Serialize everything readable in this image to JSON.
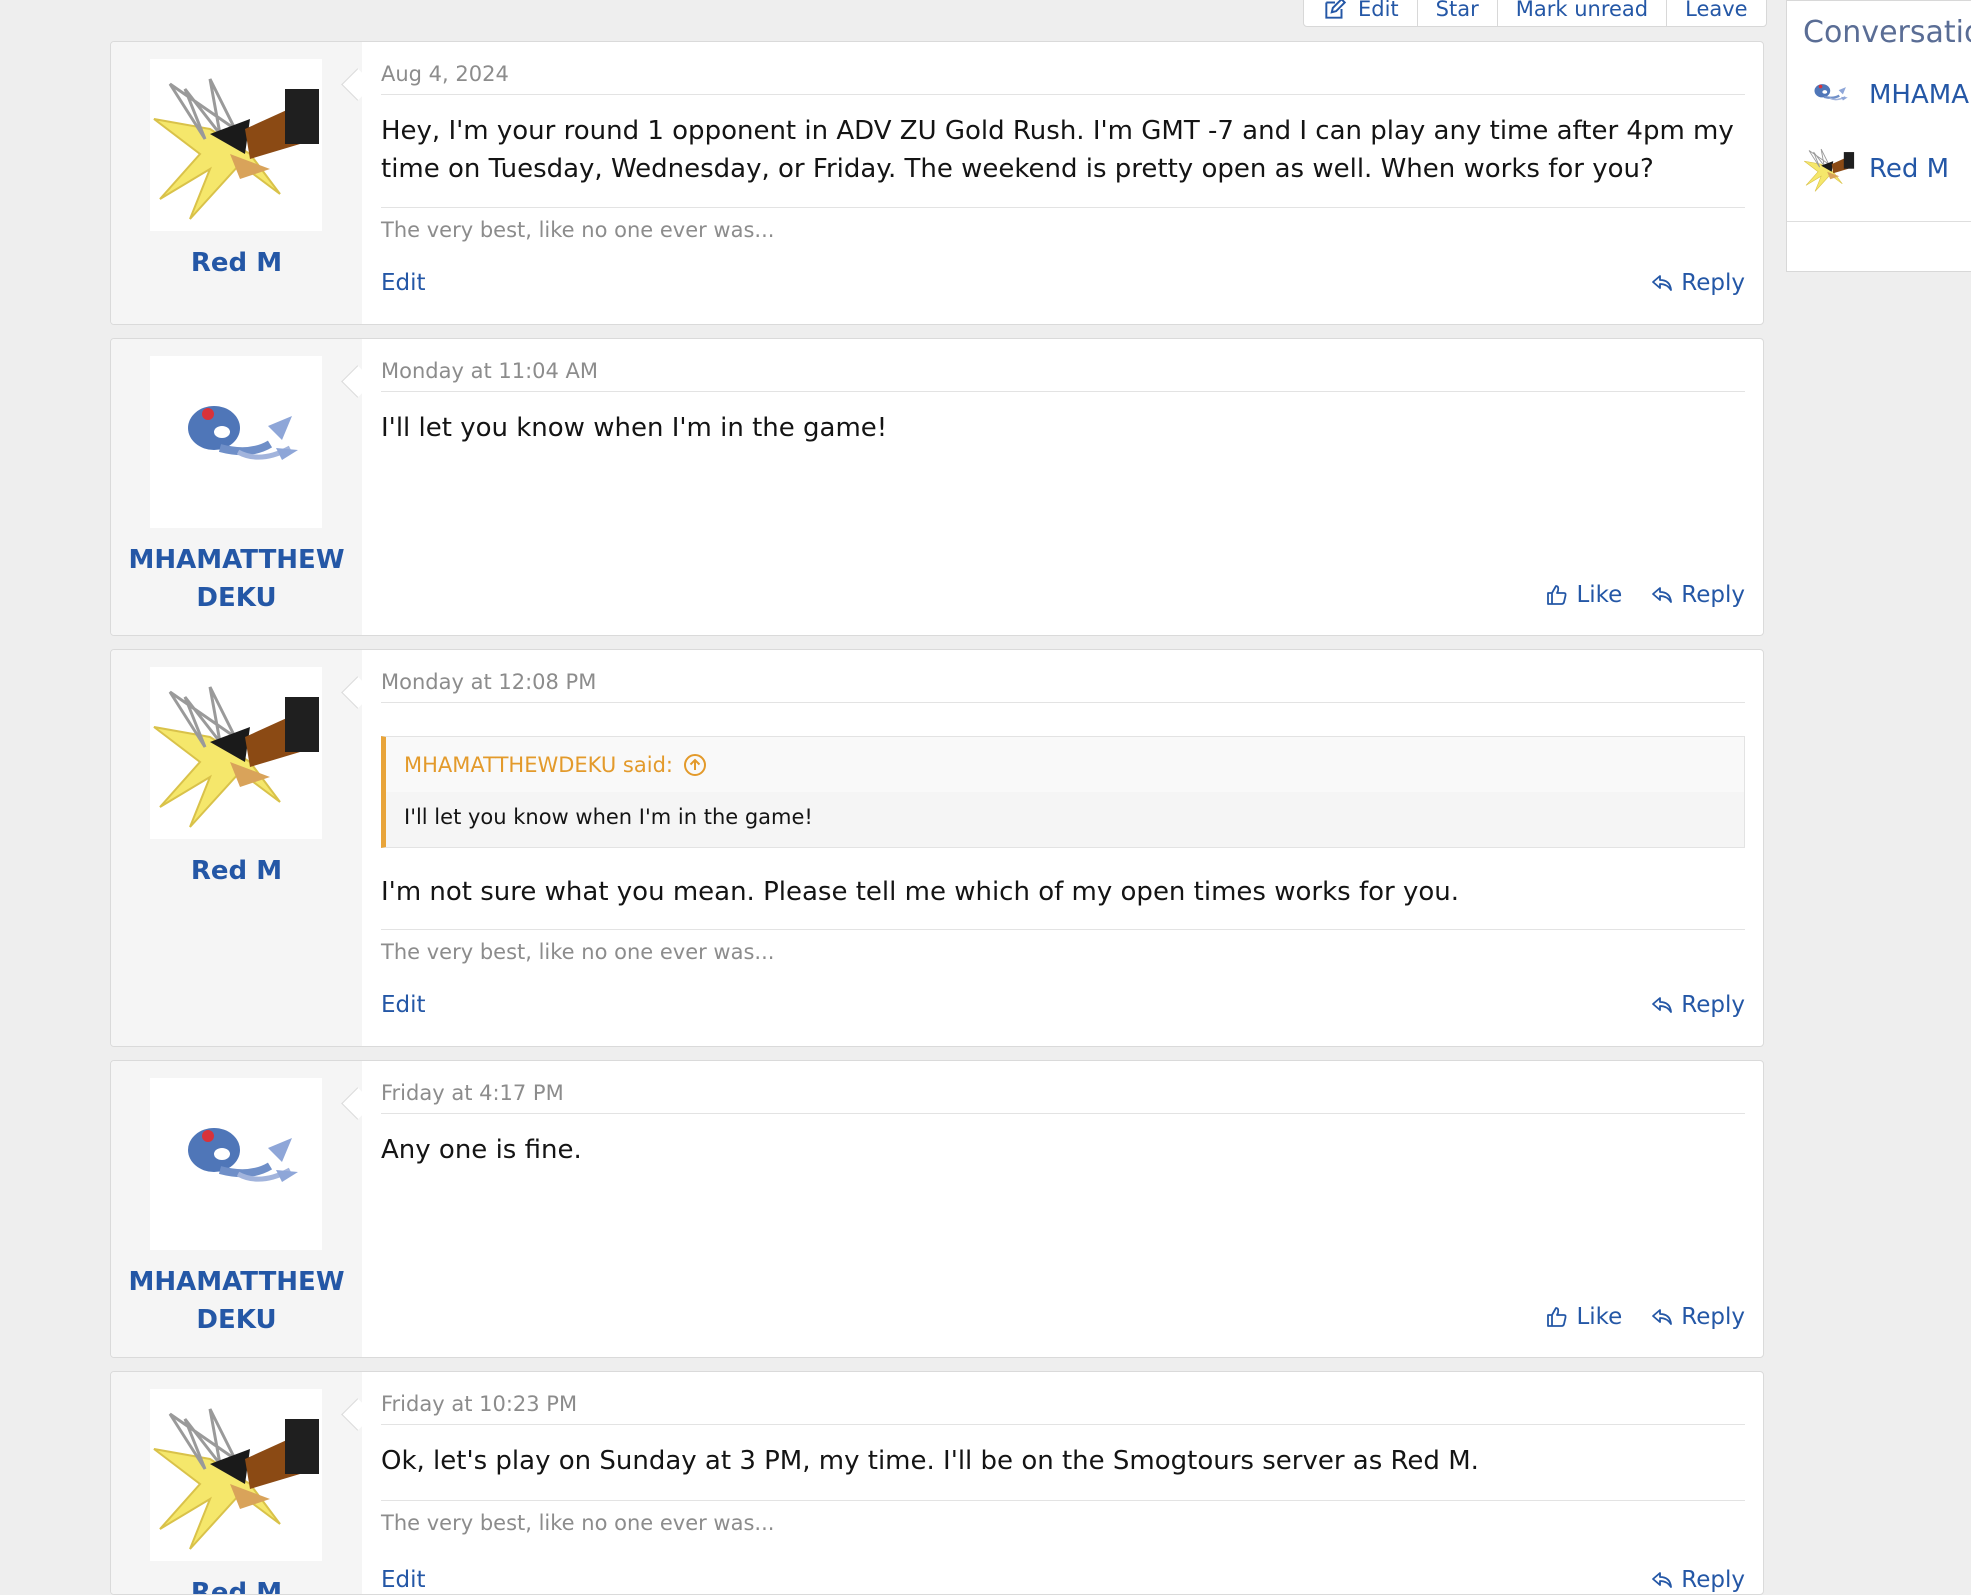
{
  "toolbar": {
    "edit_label": "Edit",
    "star_label": "Star",
    "mark_unread_label": "Mark unread",
    "leave_label": "Leave"
  },
  "sidebar": {
    "title": "Conversation",
    "participants": [
      {
        "name": "MHAMA"
      },
      {
        "name": "Red M"
      }
    ]
  },
  "messages": [
    {
      "date": "Aug 4, 2024",
      "author": "Red M",
      "text": "Hey, I'm your round 1 opponent in ADV ZU Gold Rush. I'm GMT -7 and I can play any time after 4pm my time on Tuesday, Wednesday, or Friday. The weekend is pretty open as well. When works for you?",
      "signature": "The very best, like no one ever was...",
      "edit_label": "Edit",
      "reply_label": "Reply"
    },
    {
      "date": "Monday at 11:04 AM",
      "author_line1": "MHAMATTHEW",
      "author_line2": "DEKU",
      "text": "I'll let you know when I'm in the game!",
      "like_label": "Like",
      "reply_label": "Reply"
    },
    {
      "date": "Monday at 12:08 PM",
      "author": "Red M",
      "quote_author": "MHAMATTHEWDEKU said:",
      "quote_text": "I'll let you know when I'm in the game!",
      "text": "I'm not sure what you mean. Please tell me which of my open times works for you.",
      "signature": "The very best, like no one ever was...",
      "edit_label": "Edit",
      "reply_label": "Reply"
    },
    {
      "date": "Friday at 4:17 PM",
      "author_line1": "MHAMATTHEW",
      "author_line2": "DEKU",
      "text": "Any one is fine.",
      "like_label": "Like",
      "reply_label": "Reply"
    },
    {
      "date": "Friday at 10:23 PM",
      "author": "Red M",
      "text": "Ok, let's play on Sunday at 3 PM, my time. I'll be on the Smogtours server as Red M.",
      "signature": "The very best, like no one ever was...",
      "edit_label": "Edit",
      "reply_label": "Reply"
    }
  ],
  "colors": {
    "link": "#2457a6",
    "quote_accent": "#e8a43a",
    "muted": "#8c8c8c",
    "page_bg": "#eeeeee"
  }
}
